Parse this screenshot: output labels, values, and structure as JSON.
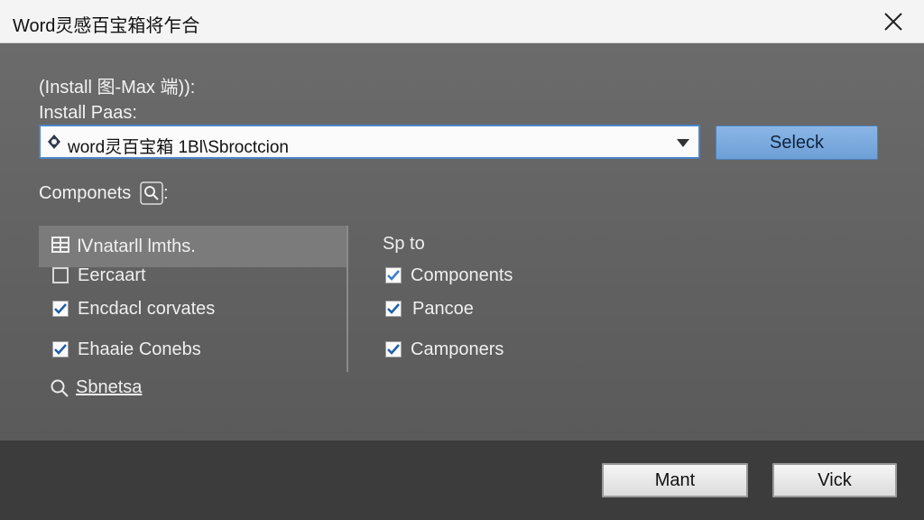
{
  "window": {
    "title": "Word灵感百宝箱将乍合"
  },
  "install": {
    "heading": "(Install 图-Max 端)):",
    "path_label": "Install Paas:",
    "path_value": "word灵百宝箱 1Bl\\Sbroctcion",
    "select_label": "Seleck"
  },
  "components": {
    "label": "Componets",
    "suffix": ":",
    "list_header": "Ⅳnatarll lmths.",
    "left_items": [
      {
        "label": "Eercaart",
        "checked": false
      },
      {
        "label": "Encdacl corvates",
        "checked": true
      },
      {
        "label": "Ehaaie Conebs",
        "checked": true
      }
    ],
    "link_label": "Sbnetsa",
    "right_header": "Sp to",
    "right_items": [
      {
        "label": "Components",
        "checked": true
      },
      {
        "label": "Pancoe",
        "checked": true
      },
      {
        "label": "Camponers",
        "checked": true
      }
    ]
  },
  "footer": {
    "primary_label": "Mant",
    "secondary_label": "Vick"
  },
  "colors": {
    "accent": "#4a86c8",
    "check": "#1f5fa8"
  }
}
